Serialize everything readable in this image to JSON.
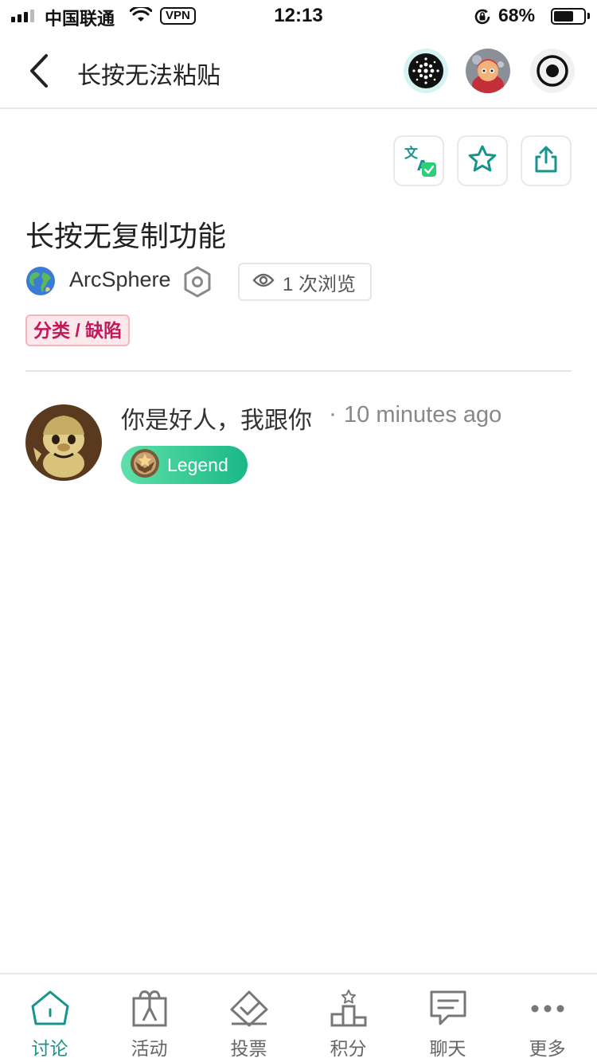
{
  "status_bar": {
    "carrier": "中国联通",
    "vpn": "VPN",
    "time": "12:13",
    "battery": "68%",
    "battery_level": 0.68
  },
  "nav": {
    "title": "长按无法粘贴",
    "icons": [
      "back-chevron-icon",
      "site-logo-icon",
      "user-avatar",
      "record-icon"
    ]
  },
  "actions": {
    "icons": [
      "translate-icon",
      "star-icon",
      "share-icon"
    ]
  },
  "topic": {
    "title": "长按无复制功能",
    "author": "ArcSphere",
    "views": "1 次浏览",
    "category": "分类 / 缺陷"
  },
  "post": {
    "author": "你是好人，我跟你",
    "separator": "·",
    "time": "10 minutes ago",
    "badge": "Legend"
  },
  "tabs": [
    {
      "label": "讨论",
      "icon": "home-icon",
      "active": true
    },
    {
      "label": "活动",
      "icon": "gift-icon",
      "active": false
    },
    {
      "label": "投票",
      "icon": "vote-icon",
      "active": false
    },
    {
      "label": "积分",
      "icon": "leaderboard-icon",
      "active": false
    },
    {
      "label": "聊天",
      "icon": "chat-icon",
      "active": false
    },
    {
      "label": "更多",
      "icon": "more-icon",
      "active": false
    }
  ],
  "colors": {
    "accent": "#15958c",
    "tag_text": "#c2185b",
    "badge_green": "#19b886"
  }
}
